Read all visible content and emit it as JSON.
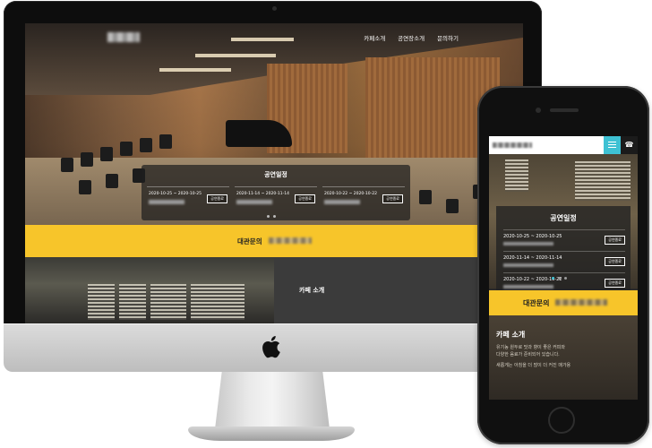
{
  "desktop_site": {
    "nav": [
      "카페소개",
      "공연장소개",
      "문의하기"
    ],
    "schedule": {
      "title": "공연일정",
      "items": [
        {
          "date": "2020-10-25 ~ 2020-10-25",
          "status": "공연종료"
        },
        {
          "date": "2020-11-14 ~ 2020-11-14",
          "status": "공연종료"
        },
        {
          "date": "2020-10-22 ~ 2020-10-22",
          "status": "공연종료"
        }
      ]
    },
    "contact_label": "대관문의",
    "cafe_title": "카페 소개"
  },
  "mobile_site": {
    "phone_icon": "☎",
    "schedule": {
      "title": "공연일정",
      "items": [
        {
          "date": "2020-10-25 ~ 2020-10-25",
          "status": "공연종료"
        },
        {
          "date": "2020-11-14 ~ 2020-11-14",
          "status": "공연종료"
        },
        {
          "date": "2020-10-22 ~ 2020-10-22",
          "status": "공연종료"
        }
      ]
    },
    "contact_label": "대관문의",
    "cafe_title": "카페 소개",
    "cafe_lines": [
      "유기농 원두로 맛과 향이 좋은 커피와",
      "다양한 음료가 준비되어 있습니다.",
      "새롭게는 아침을 더 많이 더 커진 매가용"
    ]
  },
  "colors": {
    "accent_yellow": "#f7c52a",
    "menu_teal": "#3ec1d3"
  }
}
